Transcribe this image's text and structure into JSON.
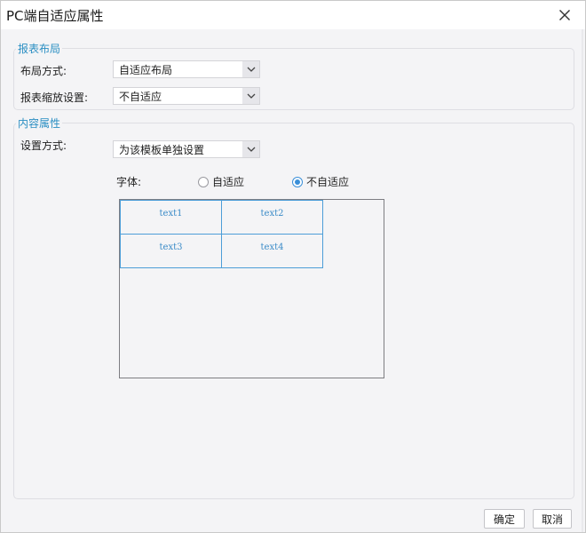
{
  "dialog": {
    "title": "PC端自适应属性"
  },
  "report_layout": {
    "group_title": "报表布局",
    "layout_label": "布局方式:",
    "layout_value": "自适应布局",
    "scale_label": "报表缩放设置:",
    "scale_value": "不自适应"
  },
  "content_props": {
    "group_title": "内容属性",
    "setting_label": "设置方式:",
    "setting_value": "为该模板单独设置",
    "font_label": "字体:",
    "font_options": [
      {
        "label": "自适应",
        "selected": false
      },
      {
        "label": "不自适应",
        "selected": true
      }
    ],
    "preview_cells": [
      "text1",
      "text2",
      "text3",
      "text4"
    ]
  },
  "footer": {
    "ok_label": "确定",
    "cancel_label": "取消"
  },
  "colors": {
    "accent": "#2b8fc3",
    "cell_border": "#4d9ed8",
    "background": "#f4f4f6"
  }
}
